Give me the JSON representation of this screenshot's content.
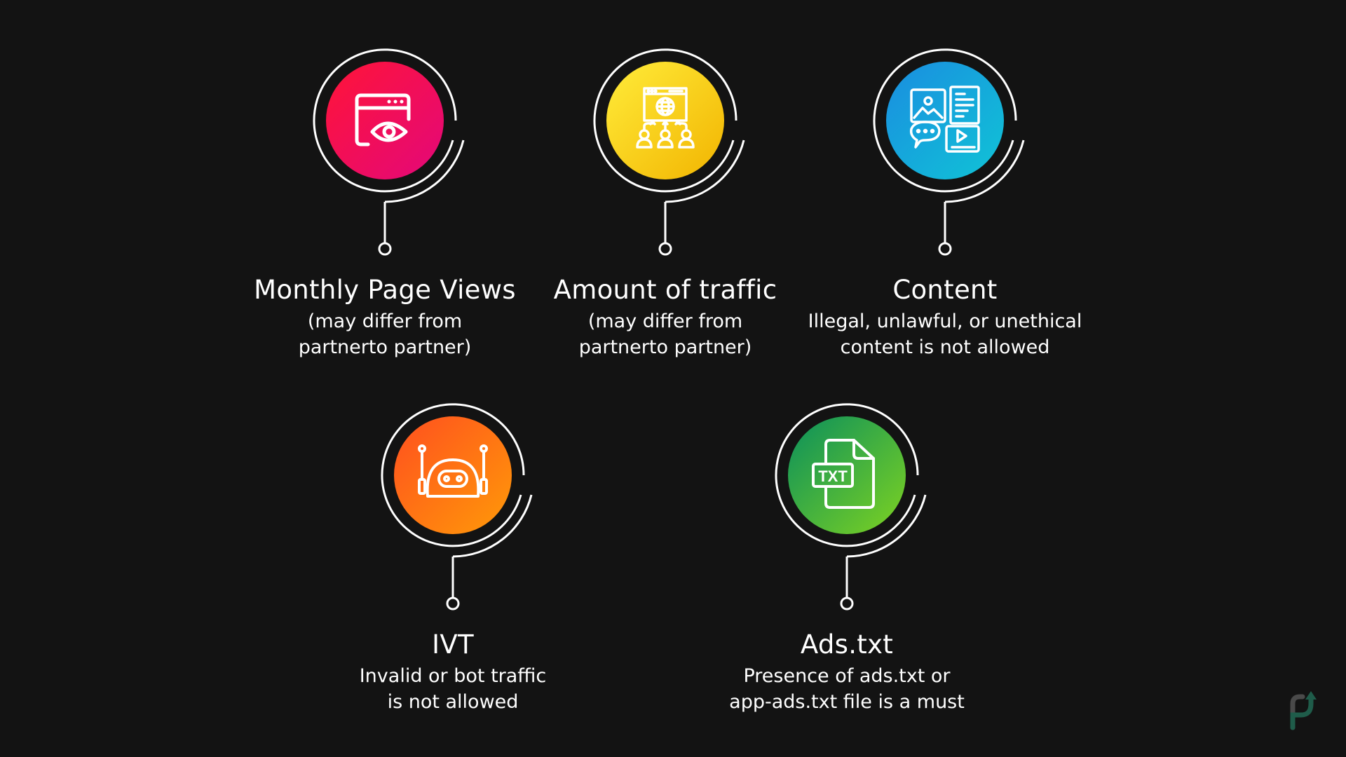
{
  "criteria": [
    {
      "id": "monthly-page-views",
      "title": "Monthly Page Views",
      "desc_lines": [
        "(may differ from",
        "partnerto partner)"
      ],
      "icon": "browser-eye-icon",
      "gradient": [
        "#ff1438",
        "#e3087a"
      ]
    },
    {
      "id": "amount-of-traffic",
      "title": "Amount of traffic",
      "desc_lines": [
        "(may differ from",
        "partnerto partner)"
      ],
      "icon": "web-traffic-users-icon",
      "gradient": [
        "#ffec3a",
        "#f2b400"
      ]
    },
    {
      "id": "content",
      "title": "Content",
      "desc_lines": [
        "Illegal, unlawful, or unethical",
        "content is not allowed"
      ],
      "icon": "content-media-icon",
      "gradient": [
        "#1a8de0",
        "#10c4d6"
      ]
    },
    {
      "id": "ivt",
      "title": "IVT",
      "desc_lines": [
        "Invalid or bot traffic",
        "is not allowed"
      ],
      "icon": "bot-icon",
      "gradient": [
        "#ff4f1f",
        "#ff9a08"
      ]
    },
    {
      "id": "ads-txt",
      "title": "Ads.txt",
      "desc_lines": [
        "Presence of ads.txt or",
        "app-ads.txt file is a must"
      ],
      "icon": "txt-file-icon",
      "icon_text": "TXT",
      "gradient": [
        "#0a8f5c",
        "#7ed321"
      ]
    }
  ],
  "colors": {
    "background": "#131313",
    "line": "#ffffff",
    "logo_gray": "#4a4a4a",
    "logo_green": "#1f5c4a"
  },
  "logo": {
    "icon": "brand-p-arrow-logo-icon"
  }
}
